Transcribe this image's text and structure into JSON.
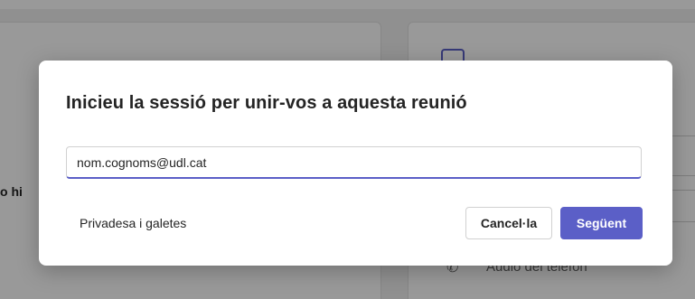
{
  "background": {
    "left_partial_text": "o hi",
    "right_option_label": "· · · · · · · · · ·",
    "phone_audio_label": "Àudio del telèfon"
  },
  "dialog": {
    "title": "Inicieu la sessió per unir-vos a aquesta reunió",
    "email_value": "nom.cognoms@udl.cat",
    "privacy_link": "Privadesa i galetes",
    "cancel_label": "Cancel·la",
    "next_label": "Següent"
  },
  "colors": {
    "accent": "#5b5fc7",
    "text": "#242424"
  }
}
